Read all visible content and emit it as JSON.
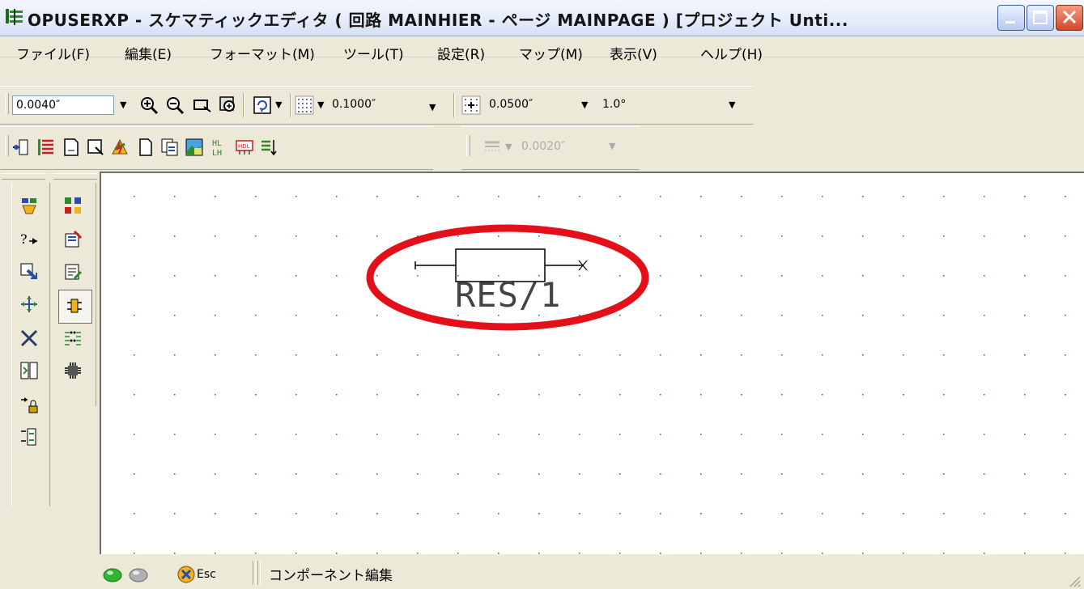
{
  "window": {
    "title": "OPUSERXP - スケマティックエディタ ( 回路 MAINHIER - ページ MAINPAGE ) [プロジェクト Unti...",
    "minimize_label": "",
    "maximize_label": "",
    "close_label": ""
  },
  "menu": [
    {
      "label": "ファイル(F)"
    },
    {
      "label": "編集(E)"
    },
    {
      "label": "フォーマット(M)"
    },
    {
      "label": "ツール(T)"
    },
    {
      "label": "設定(R)"
    },
    {
      "label": "マップ(M)"
    },
    {
      "label": "表示(V)"
    },
    {
      "label": "ヘルプ(H)"
    }
  ],
  "toolbar1": {
    "distance_value": "0.0040″",
    "grid_value": "0.1000″",
    "snap_value": "0.0500″",
    "angle_value": "1.0°"
  },
  "toolbar2": {
    "disabled_value": "0.0020″"
  },
  "canvas": {
    "component_label": "RES/1"
  },
  "status": {
    "esc_label": "Esc",
    "mode_text": "コンポーネント編集",
    "status_led_1": "#2fb52f",
    "status_led_2": "#b0b0b0"
  },
  "colors": {
    "highlight_ellipse": "#e3101a",
    "grid_dot": "#1a7a3a"
  }
}
